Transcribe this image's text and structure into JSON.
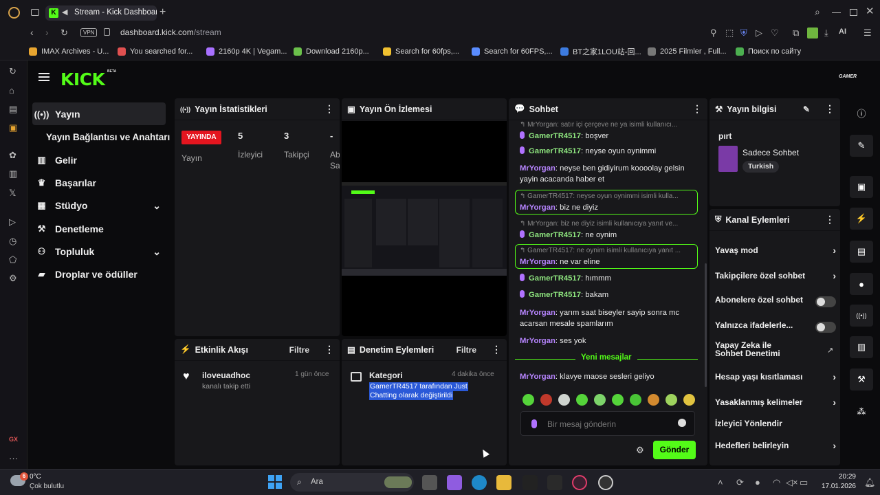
{
  "browser": {
    "tab_title": "Stream - Kick Dashboard",
    "vpn_badge": "VPN",
    "url_domain": "dashboard.kick.com",
    "url_path": "/stream",
    "ai_label": "AI",
    "gx_label": "GX",
    "bookmarks": [
      {
        "label": "IMAX Archives - U...",
        "color": "#e8a530"
      },
      {
        "label": "You searched for...",
        "color": "#e05050"
      },
      {
        "label": "2160p 4K | Vegam...",
        "color": "#a870ff"
      },
      {
        "label": "Download 2160p...",
        "color": "#6bc04b"
      },
      {
        "label": "Search for 60fps,...",
        "color": "#f0c030"
      },
      {
        "label": "Search for 60FPS,...",
        "color": "#5a8cff"
      },
      {
        "label": "BT之家1LOU站-回...",
        "color": "#3d7be0"
      },
      {
        "label": "2025 Filmler , Full...",
        "color": "#777777"
      },
      {
        "label": "Поиск по сайту",
        "color": "#4caf50"
      }
    ]
  },
  "header": {
    "logo": "KICK",
    "beta": "BETA",
    "avatar_text": "GAMER"
  },
  "sidebar": {
    "items": [
      {
        "label": "Yayın"
      },
      {
        "label": "Yayın Bağlantısı ve Anahtarı"
      },
      {
        "label": "Gelir"
      },
      {
        "label": "Başarılar"
      },
      {
        "label": "Stüdyo"
      },
      {
        "label": "Denetleme"
      },
      {
        "label": "Topluluk"
      },
      {
        "label": "Droplar ve ödüller"
      }
    ]
  },
  "stats": {
    "title": "Yayın İstatistikleri",
    "live_badge": "YAYINDA",
    "live_label": "Yayın",
    "viewers_value": "5",
    "viewers_label": "İzleyici",
    "followers_value": "3",
    "followers_label": "Takipçi",
    "third_value": "-",
    "third_label_1": "Ab",
    "third_label_2": "Sa"
  },
  "preview": {
    "title": "Yayın Ön İzlemesi"
  },
  "activity": {
    "title": "Etkinlik Akışı",
    "filter": "Filtre",
    "user": "iloveuadhoc",
    "action": "kanalı takip etti",
    "time": "1 gün önce"
  },
  "moderation": {
    "title": "Denetim Eylemleri",
    "filter": "Filtre",
    "item_title": "Kategori",
    "item_time": "4 dakika önce",
    "item_line1": "GamerTR4517 tarafından Just",
    "item_line2": "Chatting olarak değiştirildi"
  },
  "chat": {
    "title": "Sohbet",
    "messages": [
      {
        "sub": "MrYorgan: satır içi çerçeve ne ya isimli kullanıcı...",
        "user": "GamerTR4517",
        "text": "boşver"
      },
      {
        "user": "GamerTR4517",
        "text": "neyse oyun oynimmi"
      },
      {
        "user": "MrYorgan",
        "text": "neyse ben gidiyirum koooolay gelsin yayin acacanda haber et"
      },
      {
        "sub": "GamerTR4517: neyse oyun oynimmi isimli kulla...",
        "user": "MrYorgan",
        "text": "biz ne diyiz"
      },
      {
        "sub": "MrYorgan: biz ne diyiz isimli kullanıcıya yanıt ve...",
        "user": "GamerTR4517",
        "text": "ne oynim"
      },
      {
        "sub": "GamerTR4517: ne oynim isimli kullanıcıya yanıt ...",
        "user": "MrYorgan",
        "text": "ne var eline"
      },
      {
        "user": "GamerTR4517",
        "text": "hımmm"
      },
      {
        "user": "GamerTR4517",
        "text": "bakam"
      },
      {
        "user": "MrYorgan",
        "text": "yarım saat biseyler sayip sonra mc acarsan mesale spamlarım"
      },
      {
        "user": "MrYorgan",
        "text": "ses yok"
      },
      {
        "user": "MrYorgan",
        "text": "klavye maose sesleri geliyo"
      }
    ],
    "new_messages": "Yeni mesajlar",
    "placeholder": "Bir mesaj gönderin",
    "send": "Gönder"
  },
  "stream_info": {
    "title": "Yayın bilgisi",
    "stream_title": "pırt",
    "category": "Sadece Sohbet",
    "language": "Turkish"
  },
  "channel_actions": {
    "title": "Kanal Eylemleri",
    "items": [
      {
        "label": "Yavaş mod"
      },
      {
        "label": "Takipçilere özel sohbet"
      },
      {
        "label": "Abonelere özel sohbet",
        "toggle": false
      },
      {
        "label": "Yalnızca ifadelerle...",
        "toggle": false
      },
      {
        "label": "Yapay Zeka ile Sohbet Denetimi"
      },
      {
        "label": "Hesap yaşı kısıtlaması"
      },
      {
        "label": "Yasaklanmış kelimeler"
      },
      {
        "label": "İzleyici Yönlendir"
      },
      {
        "label": "Hedefleri belirleyin"
      }
    ]
  },
  "taskbar": {
    "temp": "0°C",
    "weather": "Çok bulutlu",
    "weather_badge": "6",
    "search": "Ara",
    "time": "20:29",
    "date": "17.01.2026"
  },
  "colors": {
    "accent": "#53fc18",
    "live": "#e4151f",
    "bg": "#0b0b0d",
    "panel": "#18181b"
  }
}
